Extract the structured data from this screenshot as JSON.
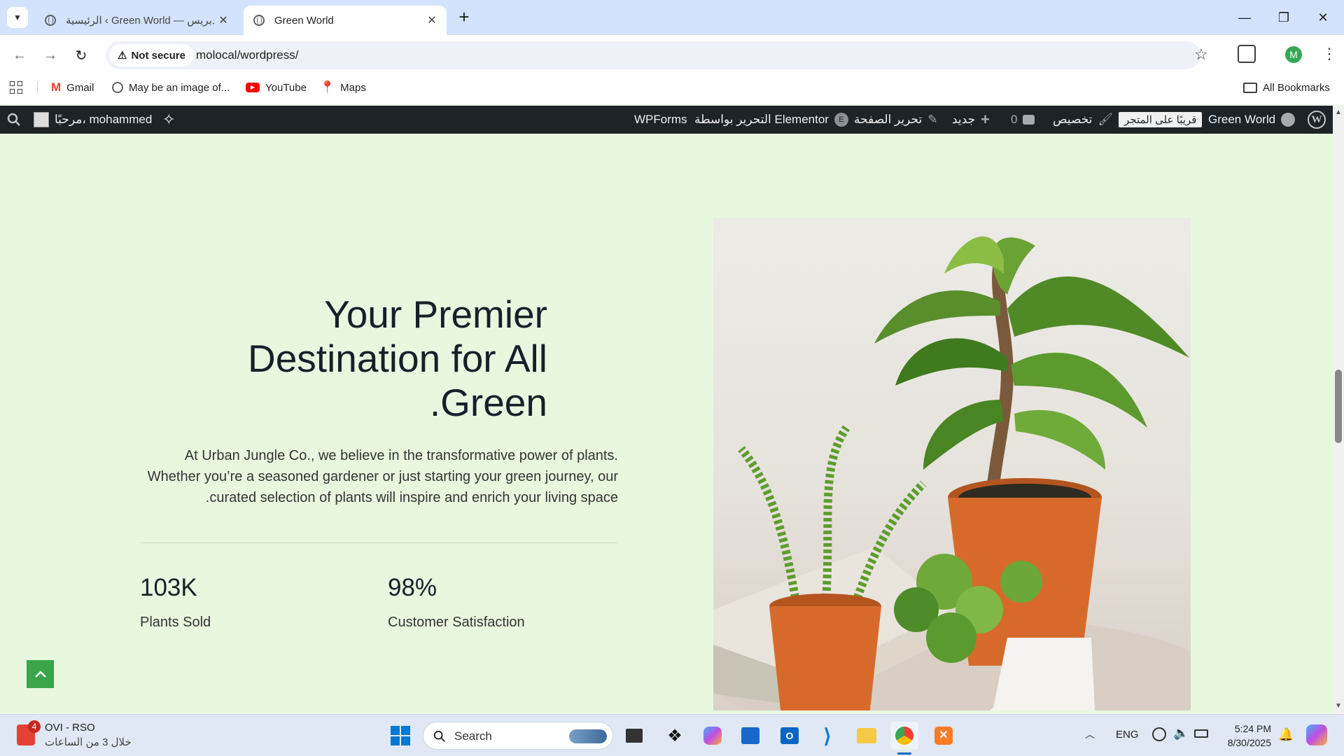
{
  "browser": {
    "tabs": [
      {
        "title": "الرئيسية ‹ Green World — ووردبريس",
        "active": false
      },
      {
        "title": "Green World",
        "active": true
      }
    ],
    "new_tab": "+",
    "url": "molocal/wordpress/",
    "security": "Not secure",
    "profile_initial": "M",
    "bookmarks": [
      "Gmail",
      "May be an image of...",
      "YouTube",
      "Maps"
    ],
    "all_bookmarks": "All Bookmarks"
  },
  "adminbar": {
    "site_name": "Green World",
    "store_badge": "قريبًا على المتجر",
    "customize": "تخصيص",
    "comments_count": "0",
    "new": "جديد",
    "edit_page": "تحرير الصفحة",
    "elementor": "التحرير بواسطة Elementor",
    "wpforms": "WPForms",
    "howdy": "مرحبًا، mohammed"
  },
  "hero": {
    "heading_lines": [
      "Your Premier",
      "Destination for All",
      ".Green"
    ],
    "intro_lines": [
      "At Urban Jungle Co., we believe in the transformative power of plants.",
      "Whether you’re a seasoned gardener or just starting your green journey, our",
      ".curated selection of plants will inspire and enrich your living space"
    ],
    "stats": [
      {
        "value": "103K",
        "label": "Plants Sold"
      },
      {
        "value": "98%",
        "label": "Customer Satisfaction"
      }
    ]
  },
  "taskbar": {
    "notif_badge": "4",
    "app_title": "OVI - RSO",
    "app_subtitle": "خلال 3 من الساعات",
    "search": "Search",
    "lang": "ENG",
    "time": "5:24 PM",
    "date": "8/30/2025"
  },
  "colors": {
    "page_bg": "#e8f8df",
    "admin_bar": "#1d2327",
    "accent_green": "#3aa54a",
    "pot": "#d76a2a"
  }
}
